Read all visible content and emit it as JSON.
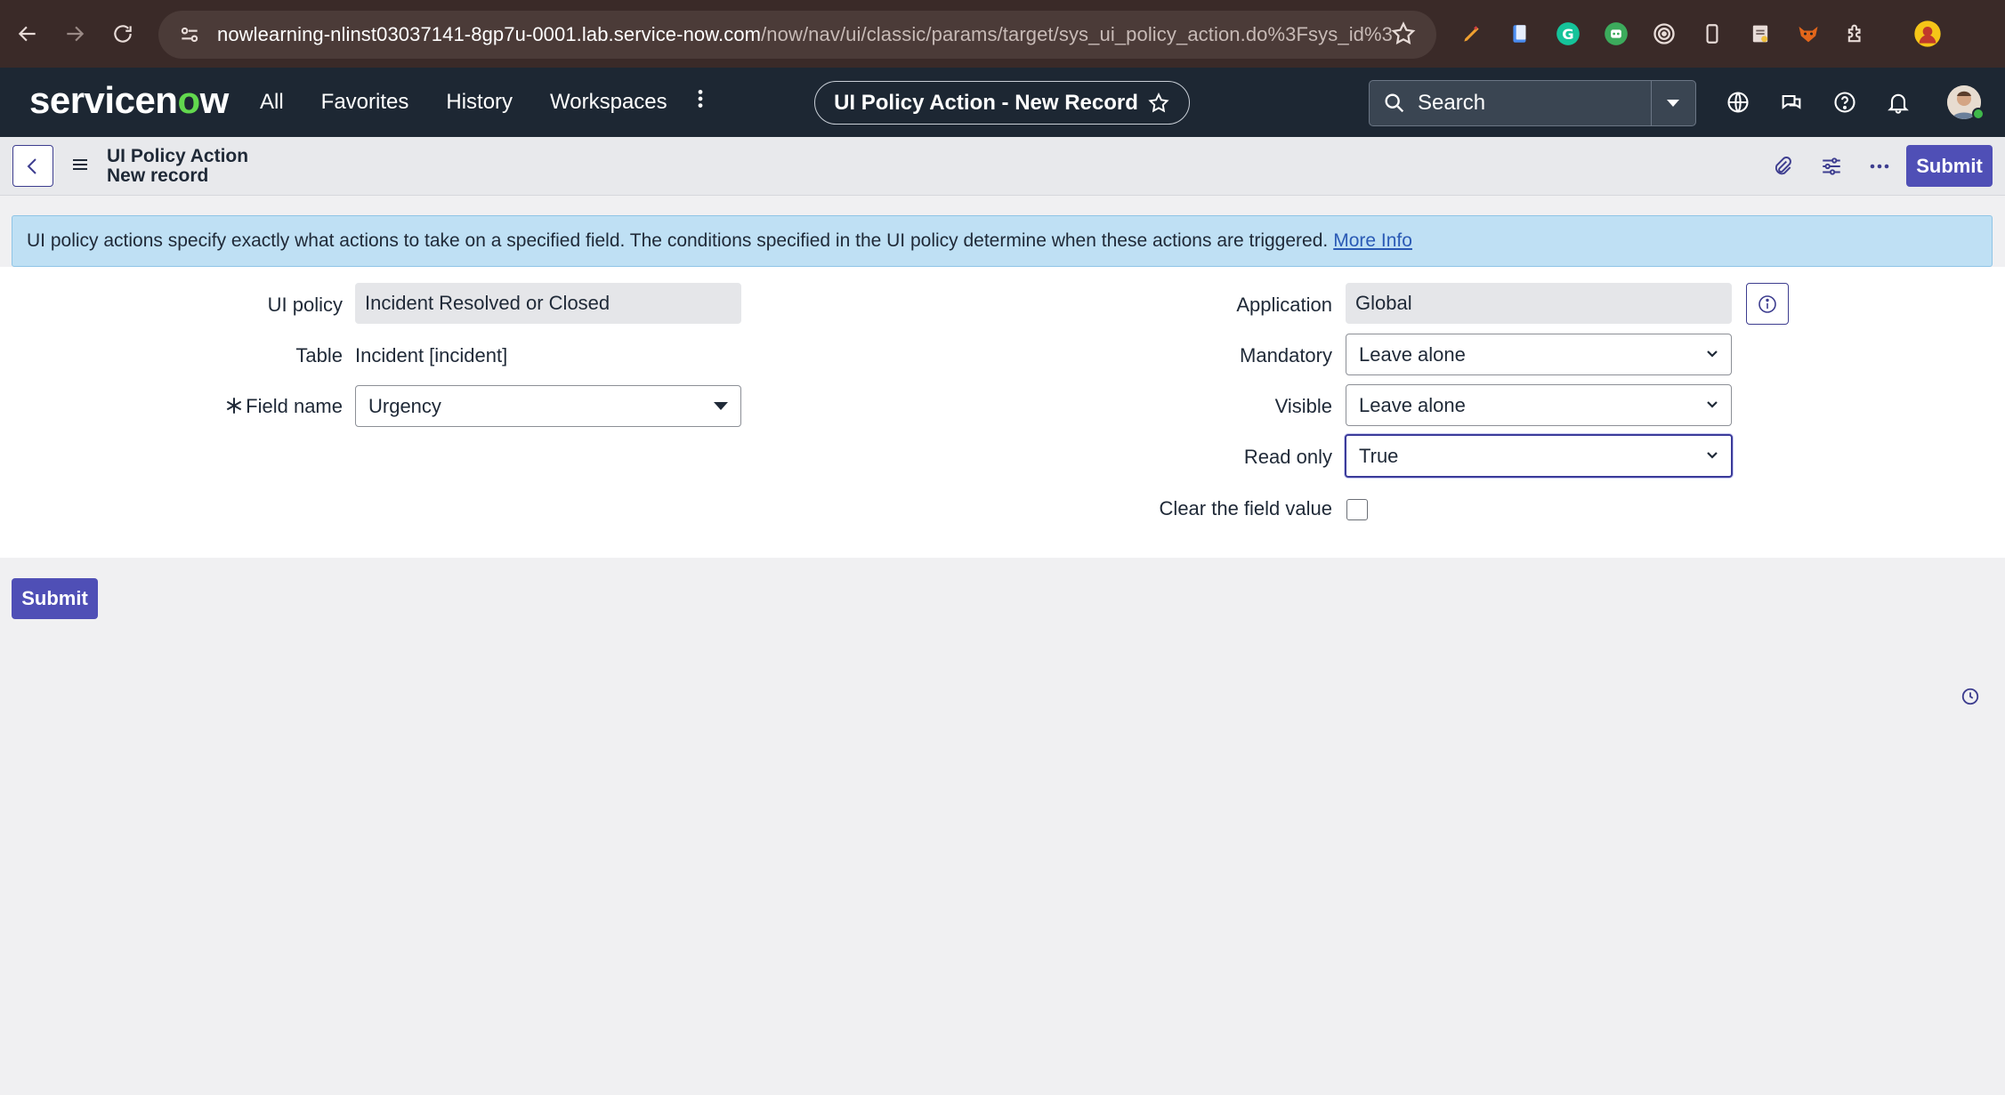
{
  "browser": {
    "url_host": "nowlearning-nlinst03037141-8gp7u-0001.lab.service-now.com",
    "url_path": "/now/nav/ui/classic/params/target/sys_ui_policy_action.do%3Fsys_id%3D-1%..."
  },
  "header": {
    "logo_prefix": "servicen",
    "logo_o": "o",
    "logo_suffix": "w",
    "menu": [
      "All",
      "Favorites",
      "History",
      "Workspaces"
    ],
    "context_title": "UI Policy Action - New Record",
    "search_placeholder": "Search"
  },
  "form_header": {
    "title": "UI Policy Action",
    "subtitle": "New record",
    "submit_label": "Submit"
  },
  "banner": {
    "text": "UI policy actions specify exactly what actions to take on a specified field. The conditions specified in the UI policy determine when these actions are triggered.",
    "link": "More Info"
  },
  "form": {
    "ui_policy": {
      "label": "UI policy",
      "value": "Incident Resolved or Closed"
    },
    "table": {
      "label": "Table",
      "value": "Incident [incident]"
    },
    "field_name": {
      "label": "Field name",
      "value": "Urgency"
    },
    "application": {
      "label": "Application",
      "value": "Global"
    },
    "mandatory": {
      "label": "Mandatory",
      "value": "Leave alone"
    },
    "visible": {
      "label": "Visible",
      "value": "Leave alone"
    },
    "read_only": {
      "label": "Read only",
      "value": "True"
    },
    "clear_value": {
      "label": "Clear the field value",
      "checked": false
    }
  },
  "footer": {
    "submit_label": "Submit"
  },
  "colors": {
    "accent": "#4f4fb6",
    "header_bg": "#1d2733",
    "banner_bg": "#bfe0f4"
  }
}
